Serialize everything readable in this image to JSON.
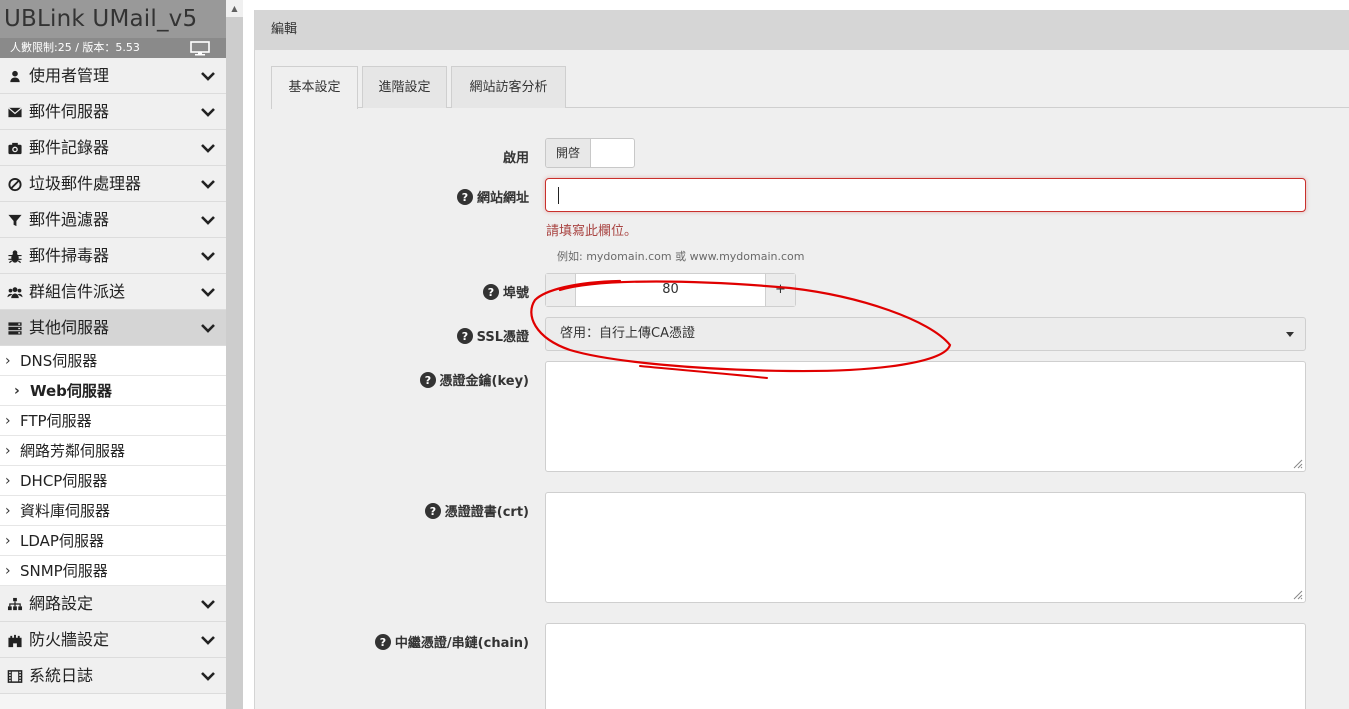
{
  "brand": {
    "title": "UBLink UMail_v5",
    "subtitle": "人數限制:25 / 版本：5.53"
  },
  "sidebar": {
    "menu_top": [
      {
        "label": "使用者管理",
        "icon": "user-icon"
      },
      {
        "label": "郵件伺服器",
        "icon": "envelope-icon"
      },
      {
        "label": "郵件記錄器",
        "icon": "camera-icon"
      },
      {
        "label": "垃圾郵件處理器",
        "icon": "ban-icon"
      },
      {
        "label": "郵件過濾器",
        "icon": "filter-icon"
      },
      {
        "label": "郵件掃毒器",
        "icon": "bug-icon"
      },
      {
        "label": "群組信件派送",
        "icon": "users-icon"
      },
      {
        "label": "其他伺服器",
        "icon": "server-icon"
      }
    ],
    "sub_items": [
      {
        "label": "DNS伺服器"
      },
      {
        "label": "Web伺服器"
      },
      {
        "label": "FTP伺服器"
      },
      {
        "label": "網路芳鄰伺服器"
      },
      {
        "label": "DHCP伺服器"
      },
      {
        "label": "資料庫伺服器"
      },
      {
        "label": "LDAP伺服器"
      },
      {
        "label": "SNMP伺服器"
      }
    ],
    "menu_bottom": [
      {
        "label": "網路設定",
        "icon": "sitemap-icon"
      },
      {
        "label": "防火牆設定",
        "icon": "fort-icon"
      },
      {
        "label": "系統日誌",
        "icon": "film-icon"
      }
    ]
  },
  "panel": {
    "heading": "編輯"
  },
  "tabs": [
    {
      "label": "基本設定",
      "active": true
    },
    {
      "label": "進階設定",
      "active": false
    },
    {
      "label": "網站訪客分析",
      "active": false
    }
  ],
  "form": {
    "enable_label": "啟用",
    "enable_toggle_text": "開啓",
    "site_url_label": "網站網址",
    "site_url_value": "",
    "site_url_error": "請填寫此欄位。",
    "site_url_hint": "例如: mydomain.com 或 www.mydomain.com",
    "port_label": "埠號",
    "port_value": "80",
    "port_minus": "-",
    "port_plus": "+",
    "ssl_label": "SSL憑證",
    "ssl_value": "啓用：自行上傳CA憑證",
    "key_label": "憑證金鑰(key)",
    "crt_label": "憑證證書(crt)",
    "chain_label": "中繼憑證/串鏈(chain)"
  },
  "colors": {
    "annotation": "#e00000",
    "error": "#a94442"
  }
}
